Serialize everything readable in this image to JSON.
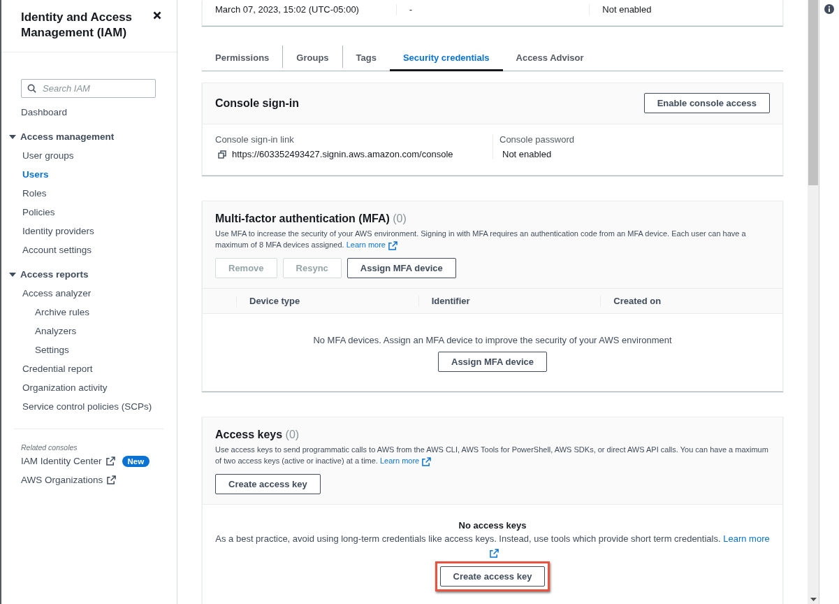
{
  "sidebar": {
    "title": "Identity and Access Management (IAM)",
    "search": {
      "placeholder": "Search IAM"
    },
    "items": [
      {
        "kind": "link",
        "label": "Dashboard",
        "selected": false
      },
      {
        "kind": "section",
        "label": "Access management",
        "expanded": true,
        "children": [
          {
            "label": "User groups",
            "selected": false
          },
          {
            "label": "Users",
            "selected": true
          },
          {
            "label": "Roles",
            "selected": false
          },
          {
            "label": "Policies",
            "selected": false
          },
          {
            "label": "Identity providers",
            "selected": false
          },
          {
            "label": "Account settings",
            "selected": false
          }
        ]
      },
      {
        "kind": "section",
        "label": "Access reports",
        "expanded": true,
        "children": [
          {
            "label": "Access analyzer",
            "selected": false,
            "children": [
              {
                "label": "Archive rules",
                "selected": false
              },
              {
                "label": "Analyzers",
                "selected": false
              },
              {
                "label": "Settings",
                "selected": false
              }
            ]
          },
          {
            "label": "Credential report",
            "selected": false
          },
          {
            "label": "Organization activity",
            "selected": false
          },
          {
            "label": "Service control policies (SCPs)",
            "selected": false
          }
        ]
      }
    ],
    "related": {
      "heading": "Related consoles",
      "links": [
        {
          "label": "IAM Identity Center",
          "badge": "New"
        },
        {
          "label": "AWS Organizations"
        }
      ]
    }
  },
  "summary": {
    "values": [
      "March 07, 2023, 15:02 (UTC-05:00)",
      "-",
      "Not enabled"
    ]
  },
  "tabs": [
    {
      "label": "Permissions",
      "selected": false
    },
    {
      "label": "Groups",
      "selected": false
    },
    {
      "label": "Tags",
      "selected": false
    },
    {
      "label": "Security credentials",
      "selected": true
    },
    {
      "label": "Access Advisor",
      "selected": false
    }
  ],
  "console_signin": {
    "title": "Console sign-in",
    "button": "Enable console access",
    "fields": [
      {
        "label": "Console sign-in link",
        "value": "https://603352493427.signin.aws.amazon.com/console",
        "copyable": true
      },
      {
        "label": "Console password",
        "value": "Not enabled",
        "copyable": false
      }
    ]
  },
  "mfa": {
    "title": "Multi-factor authentication (MFA)",
    "count": "(0)",
    "description": "Use MFA to increase the security of your AWS environment. Signing in with MFA requires an authentication code from an MFA device. Each user can have a maximum of 8 MFA devices assigned.",
    "learn_more": "Learn more",
    "buttons": [
      {
        "label": "Remove",
        "disabled": true
      },
      {
        "label": "Resync",
        "disabled": true
      },
      {
        "label": "Assign MFA device",
        "disabled": false
      }
    ],
    "columns": [
      "Device type",
      "Identifier",
      "Created on"
    ],
    "empty_text": "No MFA devices. Assign an MFA device to improve the security of your AWS environment",
    "empty_button": "Assign MFA device"
  },
  "access_keys": {
    "title": "Access keys",
    "count": "(0)",
    "description": "Use access keys to send programmatic calls to AWS from the AWS CLI, AWS Tools for PowerShell, AWS SDKs, or direct AWS API calls. You can have a maximum of two access keys (active or inactive) at a time.",
    "learn_more": "Learn more",
    "button": "Create access key",
    "empty_title": "No access keys",
    "empty_text": "As a best practice, avoid using long-term credentials like access keys. Instead, use tools which provide short term credentials.",
    "empty_learn_more": "Learn more",
    "empty_button": {
      "label": "Create access key",
      "highlighted": true
    }
  }
}
